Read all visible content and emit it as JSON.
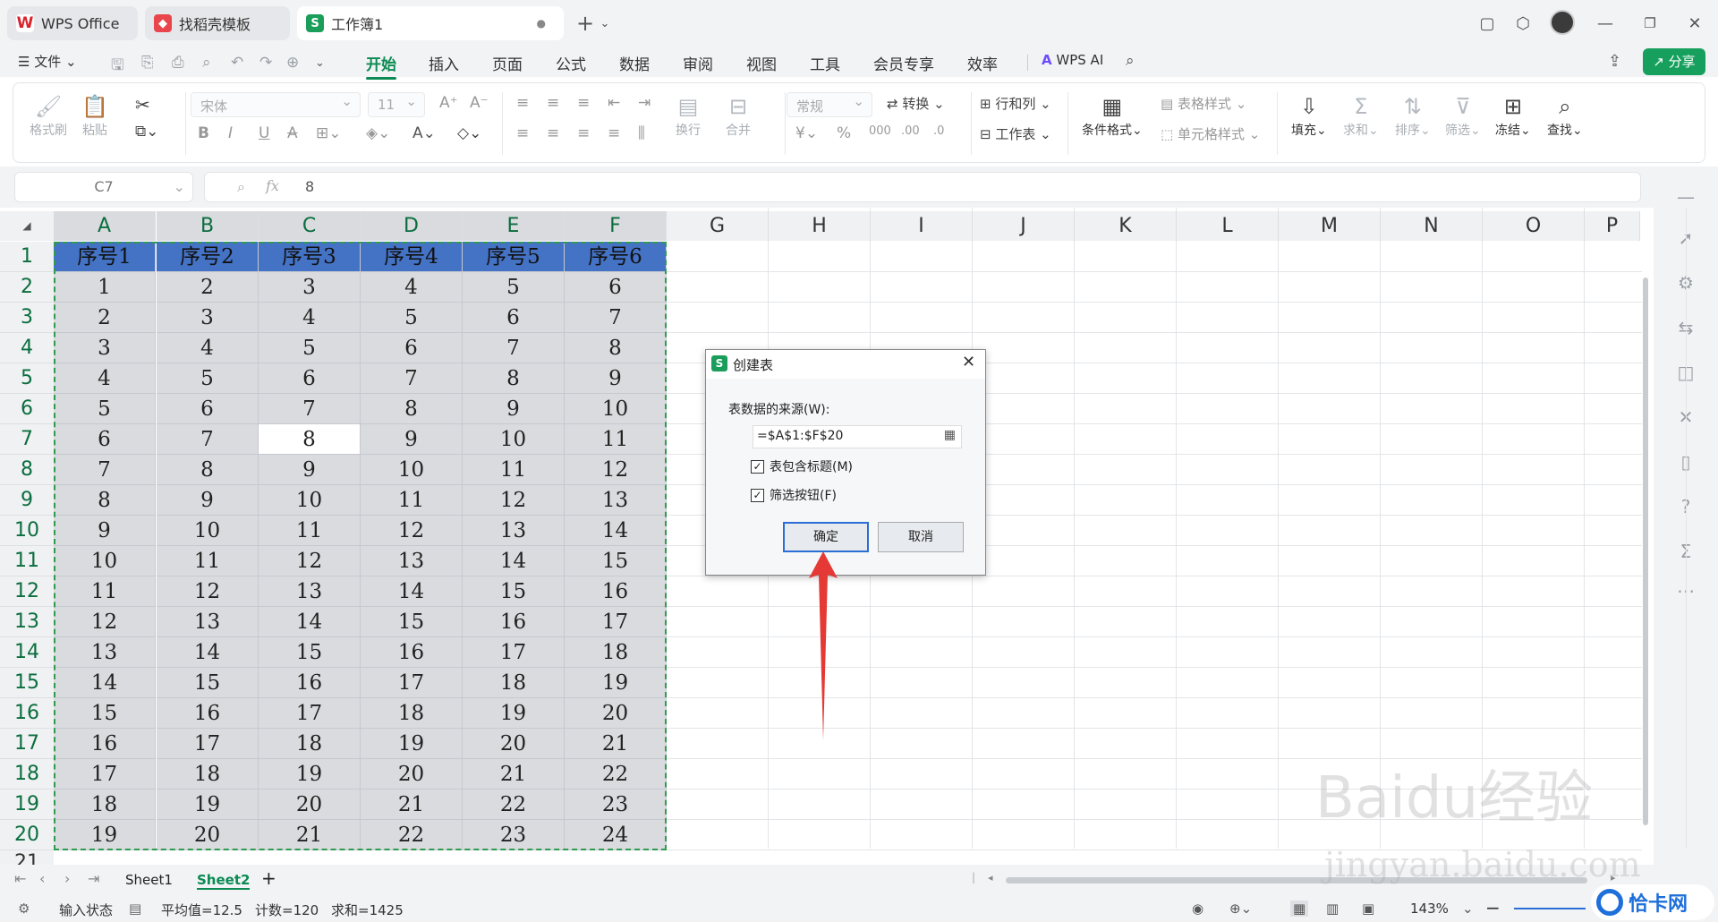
{
  "tabs": [
    {
      "label": "WPS Office",
      "icon": "wps-logo-icon"
    },
    {
      "label": "找稻壳模板",
      "icon": "docer-icon"
    },
    {
      "label": "工作簿1",
      "icon": "spreadsheet-icon"
    }
  ],
  "menu": {
    "file": "文件",
    "items": [
      "开始",
      "插入",
      "页面",
      "公式",
      "数据",
      "审阅",
      "视图",
      "工具",
      "会员专享",
      "效率"
    ],
    "active": "开始",
    "ai": "WPS AI",
    "share": "分享"
  },
  "ribbon": {
    "format_painter": "格式刷",
    "paste": "粘贴",
    "font_name": "宋体",
    "font_size": "11",
    "wrap": "换行",
    "merge": "合并",
    "number_format": "常规",
    "convert": "转换",
    "row_col": "行和列",
    "worksheet": "工作表",
    "cond_format": "条件格式",
    "table_style": "表格样式",
    "cell_style": "单元格样式",
    "fill": "填充",
    "sum": "求和",
    "sort": "排序",
    "filter": "筛选",
    "freeze": "冻结",
    "find": "查找"
  },
  "formula": {
    "cell_ref": "C7",
    "value": "8",
    "fx": "fx"
  },
  "columns": [
    "A",
    "B",
    "C",
    "D",
    "E",
    "F",
    "G",
    "H",
    "I",
    "J",
    "K",
    "L",
    "M",
    "N",
    "O",
    "P"
  ],
  "header_row": [
    "序号1",
    "序号2",
    "序号3",
    "序号4",
    "序号5",
    "序号6"
  ],
  "row_numbers": [
    "1",
    "2",
    "3",
    "4",
    "5",
    "6",
    "7",
    "8",
    "9",
    "10",
    "11",
    "12",
    "13",
    "14",
    "15",
    "16",
    "17",
    "18",
    "19",
    "20",
    "21"
  ],
  "data_rows": [
    [
      1,
      2,
      3,
      4,
      5,
      6
    ],
    [
      2,
      3,
      4,
      5,
      6,
      7
    ],
    [
      3,
      4,
      5,
      6,
      7,
      8
    ],
    [
      4,
      5,
      6,
      7,
      8,
      9
    ],
    [
      5,
      6,
      7,
      8,
      9,
      10
    ],
    [
      6,
      7,
      8,
      9,
      10,
      11
    ],
    [
      7,
      8,
      9,
      10,
      11,
      12
    ],
    [
      8,
      9,
      10,
      11,
      12,
      13
    ],
    [
      9,
      10,
      11,
      12,
      13,
      14
    ],
    [
      10,
      11,
      12,
      13,
      14,
      15
    ],
    [
      11,
      12,
      13,
      14,
      15,
      16
    ],
    [
      12,
      13,
      14,
      15,
      16,
      17
    ],
    [
      13,
      14,
      15,
      16,
      17,
      18
    ],
    [
      14,
      15,
      16,
      17,
      18,
      19
    ],
    [
      15,
      16,
      17,
      18,
      19,
      20
    ],
    [
      16,
      17,
      18,
      19,
      20,
      21
    ],
    [
      17,
      18,
      19,
      20,
      21,
      22
    ],
    [
      18,
      19,
      20,
      21,
      22,
      23
    ],
    [
      19,
      20,
      21,
      22,
      23,
      24
    ]
  ],
  "dialog": {
    "title": "创建表",
    "source_label": "表数据的来源(W):",
    "source_value": "=$A$1:$F$20",
    "has_header": "表包含标题(M)",
    "filter_button": "筛选按钮(F)",
    "ok": "确定",
    "cancel": "取消"
  },
  "sheets": [
    "Sheet1",
    "Sheet2"
  ],
  "active_sheet": "Sheet2",
  "status": {
    "mode": "输入状态",
    "average": "平均值=12.5",
    "count": "计数=120",
    "sum": "求和=1425",
    "zoom": "143%"
  },
  "watermark": {
    "brand": "Baidu经验",
    "url": "jingyan.baidu.com",
    "corner": "恰卡网"
  },
  "colors": {
    "accent": "#0b8a53",
    "header_fill": "#4472c4",
    "selection_border": "#2e9b4e",
    "arrow": "#e53935"
  }
}
